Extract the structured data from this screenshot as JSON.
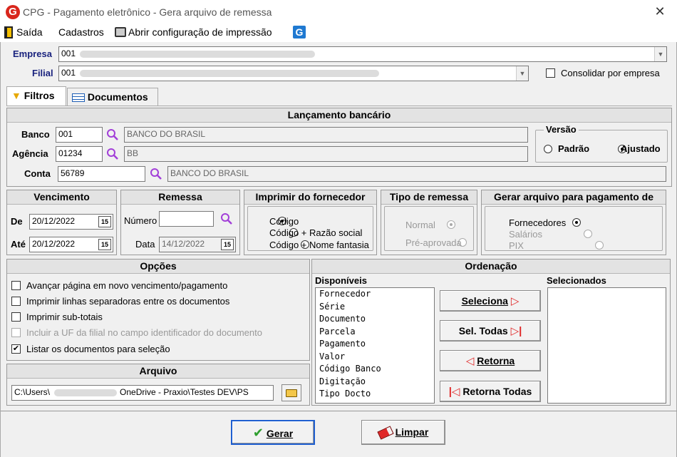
{
  "window": {
    "title": "CPG - Pagamento eletrônico - Gera arquivo de remessa",
    "logo": "G",
    "close": "✕"
  },
  "menu": {
    "saida": "Saída",
    "cadastros": "Cadastros",
    "impressao": "Abrir configuração de impressão",
    "g_icon": "G"
  },
  "empresa": {
    "label": "Empresa",
    "value": "001"
  },
  "filial": {
    "label": "Filial",
    "value": "001",
    "consolidar_label": "Consolidar por empresa",
    "consolidar_checked": false
  },
  "tabs": [
    {
      "label": "Filtros",
      "icon": "filter-icon"
    },
    {
      "label": "Documentos",
      "icon": "table-icon"
    }
  ],
  "lancamento": {
    "title": "Lançamento bancário",
    "banco": {
      "label": "Banco",
      "code": "001",
      "name": "BANCO DO BRASIL"
    },
    "agencia": {
      "label": "Agência",
      "code": "01234",
      "name": "BB"
    },
    "conta": {
      "label": "Conta",
      "code": "56789",
      "name": "BANCO DO BRASIL"
    }
  },
  "versao": {
    "title": "Versão",
    "options": [
      "Padrão",
      "Ajustado"
    ],
    "selected": "Ajustado"
  },
  "vencimento": {
    "title": "Vencimento",
    "de_label": "De",
    "de": "20/12/2022",
    "ate_label": "Até",
    "ate": "20/12/2022",
    "cal_icon": "15"
  },
  "remessa": {
    "title": "Remessa",
    "numero_label": "Número",
    "numero": "",
    "data_label": "Data",
    "data": "14/12/2022"
  },
  "imprimir_fornecedor": {
    "title": "Imprimir do fornecedor",
    "options": [
      "Código",
      "Código + Razão social",
      "Código + Nome fantasia"
    ],
    "selected": "Código"
  },
  "tipo_remessa": {
    "title": "Tipo de remessa",
    "options": [
      "Normal",
      "Pré-aprovada"
    ],
    "selected": "Normal"
  },
  "gerar_arquivo": {
    "title": "Gerar arquivo para pagamento de",
    "options": [
      "Fornecedores",
      "Salários",
      "PIX"
    ],
    "selected": "Fornecedores"
  },
  "opcoes": {
    "title": "Opções",
    "items": [
      {
        "label": "Avançar página em novo vencimento/pagamento",
        "checked": false,
        "disabled": false
      },
      {
        "label": "Imprimir linhas separadoras entre os documentos",
        "checked": false,
        "disabled": false
      },
      {
        "label": "Imprimir sub-totais",
        "checked": false,
        "disabled": false
      },
      {
        "label": "Incluir a UF da filial no campo identificador do documento",
        "checked": false,
        "disabled": true
      },
      {
        "label": "Listar os documentos para seleção",
        "checked": true,
        "disabled": false
      }
    ]
  },
  "arquivo": {
    "title": "Arquivo",
    "path_prefix": "C:\\Users\\",
    "path_suffix": "OneDrive - Praxio\\Testes DEV\\PS"
  },
  "ordenacao": {
    "title": "Ordenação",
    "disponiveis_label": "Disponíveis",
    "selecionados_label": "Selecionados",
    "disponiveis": [
      "Fornecedor",
      "Série",
      "Documento",
      "Parcela",
      "Pagamento",
      "Valor",
      "Código Banco",
      "Digitação",
      "Tipo Docto"
    ],
    "buttons": {
      "seleciona": "Seleciona",
      "sel_todas": "Sel. Todas",
      "retorna": "Retorna",
      "retorna_todas": "Retorna Todas"
    }
  },
  "footer": {
    "gerar": "Gerar",
    "limpar": "Limpar"
  }
}
